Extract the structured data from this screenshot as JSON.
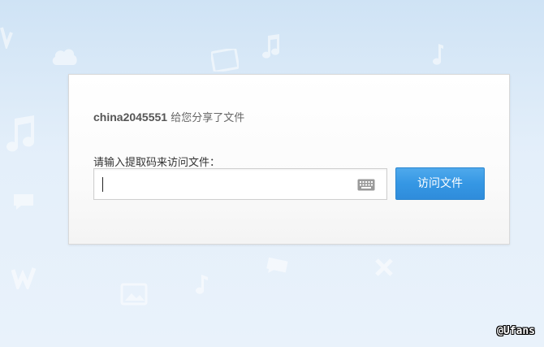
{
  "share": {
    "username": "china2045551",
    "message": " 给您分享了文件"
  },
  "form": {
    "prompt_label": "请输入提取码来访问文件：",
    "code_value": "",
    "visit_button_label": "访问文件"
  },
  "watermark": "@Ufans",
  "icons": {
    "keyboard": "keyboard-icon",
    "background": [
      "music-note-icon",
      "cloud-icon",
      "image-icon",
      "word-doc-icon",
      "excel-doc-icon",
      "chat-bubble-icon"
    ]
  },
  "colors": {
    "accent": "#3597e4",
    "background_top": "#cfe3f5",
    "background_bottom": "#e9f2fb",
    "card_border": "#d9d9d9"
  }
}
